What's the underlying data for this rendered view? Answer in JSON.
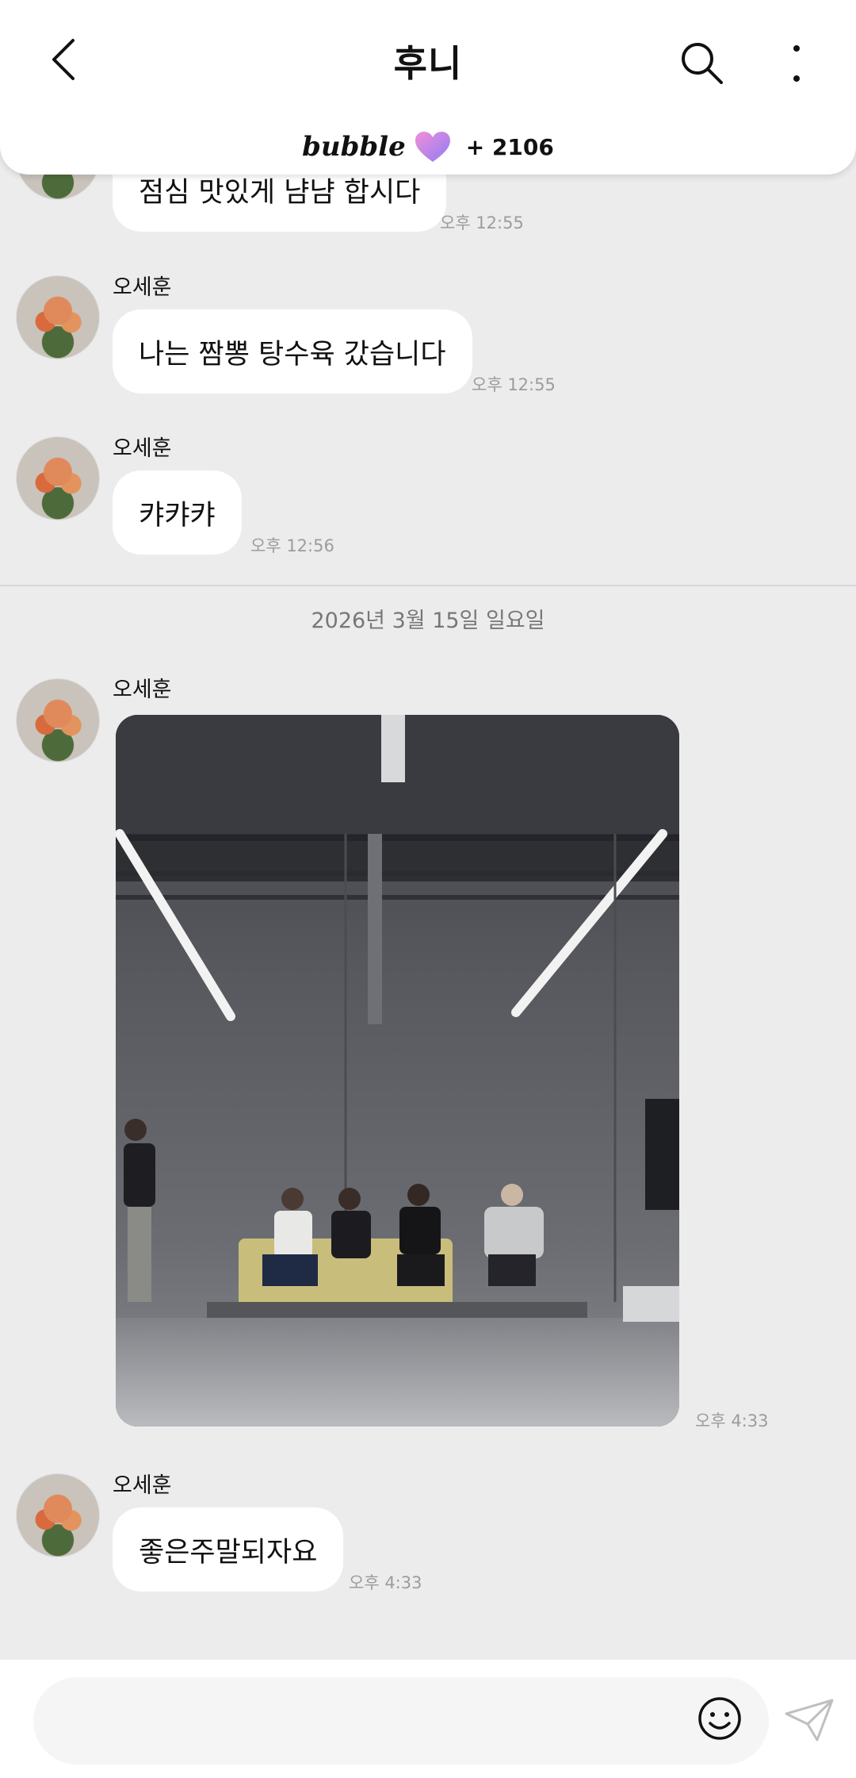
{
  "header": {
    "title": "후니",
    "bubble_brand": "bubble",
    "bubble_count": "+ 2106",
    "heart_color": "#b68cf5"
  },
  "messages": [
    {
      "sender": "",
      "text": "점심 맛있게 냠냠 합시다",
      "time": "오후 12:55"
    },
    {
      "sender": "오세훈",
      "text": "나는 짬뽕 탕수육 갔습니다",
      "time": "오후 12:55"
    },
    {
      "sender": "오세훈",
      "text": "캬캬캬",
      "time": "오후 12:56"
    },
    {
      "sender": "오세훈",
      "text": "",
      "time": "오후 4:33"
    },
    {
      "sender": "오세훈",
      "text": "좋은주말되자요",
      "time": "오후 4:33"
    }
  ],
  "date_divider": "2026년 3월 15일 일요일",
  "input": {
    "placeholder": ""
  },
  "icons": {
    "back": "back-arrow-icon",
    "search": "search-icon",
    "more": "more-vertical-icon",
    "emoji": "emoji-smile-icon",
    "send": "paper-plane-icon"
  },
  "colors": {
    "background": "#ececed",
    "bubble": "#ffffff",
    "time": "#9c9c9c"
  }
}
